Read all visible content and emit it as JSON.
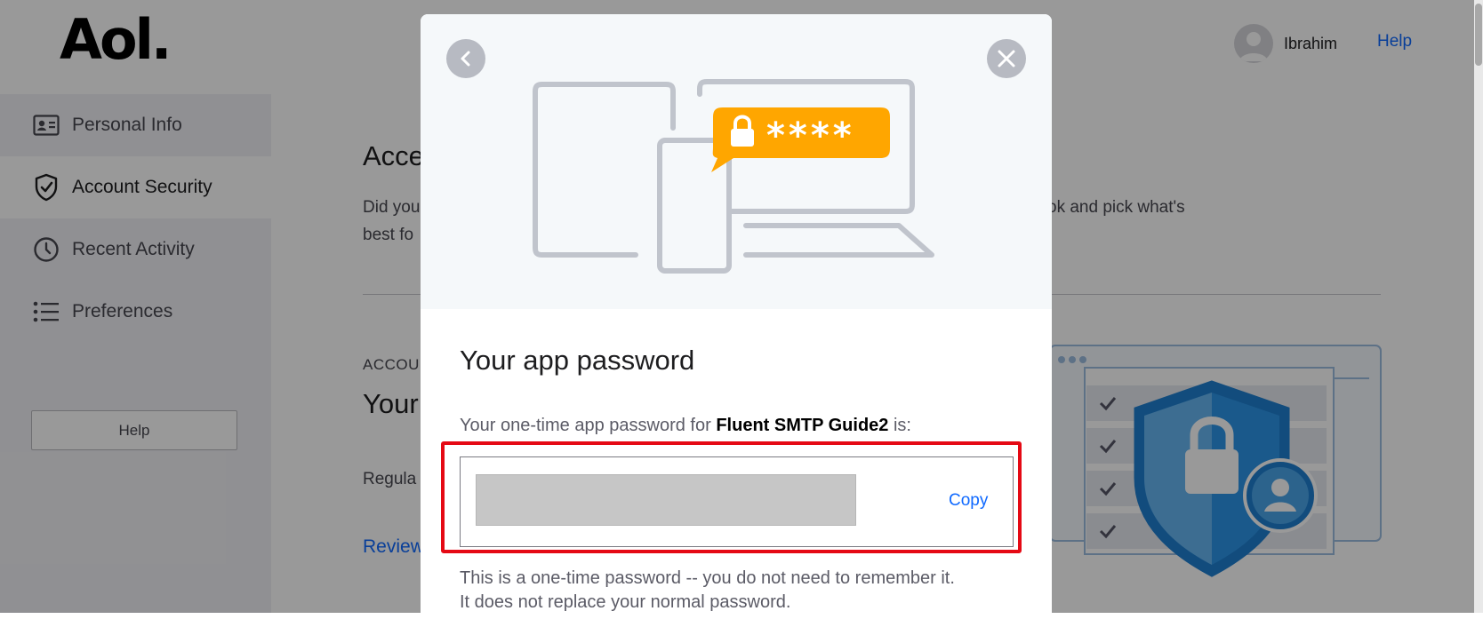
{
  "brand": {
    "logo_text": "Aol."
  },
  "header": {
    "user_name": "Ibrahim",
    "help_link": "Help"
  },
  "sidebar": {
    "items": [
      {
        "label": "Personal Info",
        "icon": "id-card-icon",
        "active": false
      },
      {
        "label": "Account Security",
        "icon": "shield-check-icon",
        "active": true
      },
      {
        "label": "Recent Activity",
        "icon": "clock-icon",
        "active": false
      },
      {
        "label": "Preferences",
        "icon": "list-icon",
        "active": false
      }
    ],
    "help_button": "Help"
  },
  "main": {
    "title": "Acce",
    "description_start": "Did you",
    "description_line2": "best fo",
    "description_tail": "ok and pick what's",
    "section_label": "ACCOU",
    "section_heading": "Your issue",
    "section_text": "Regula activity",
    "review_link": "Review"
  },
  "modal": {
    "title": "Your app password",
    "description_prefix": "Your one-time app password for",
    "app_name": "Fluent SMTP Guide2",
    "description_suffix": "is:",
    "copy_label": "Copy",
    "note_line1": "This is a one-time password -- you do not need to remember it.",
    "note_line2": "It does not replace your normal password.",
    "illustration_badge": "****"
  },
  "colors": {
    "accent": "#0f69ff",
    "highlight": "#e50914",
    "badge": "#ffa600",
    "overlay": "rgba(0,0,0,0.40)"
  }
}
